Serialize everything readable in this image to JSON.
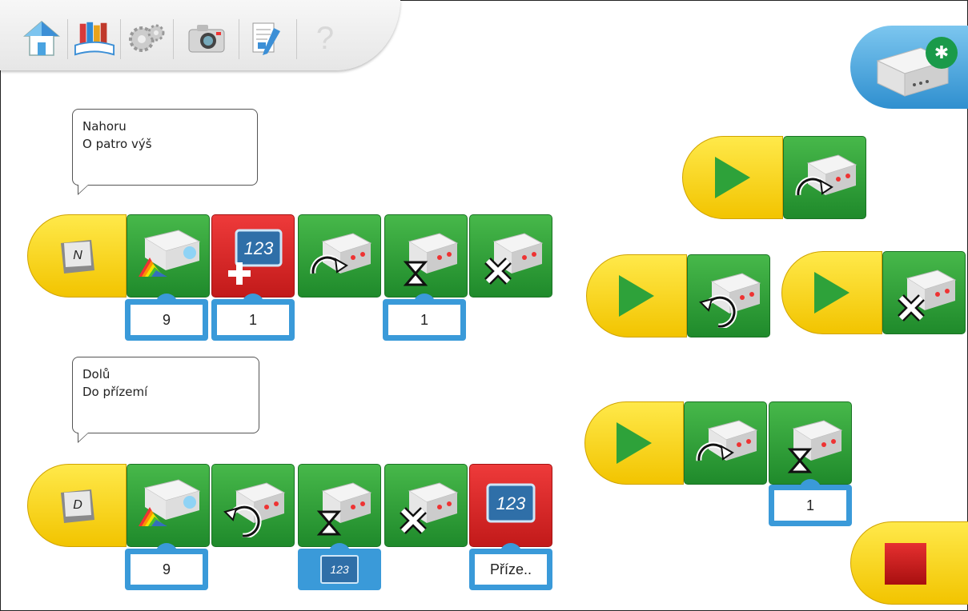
{
  "toolbar": {
    "icons": [
      "home-icon",
      "library-icon",
      "gears-icon",
      "camera-icon",
      "document-icon",
      "help-icon"
    ],
    "help_label": "?"
  },
  "comments": [
    {
      "line1": "Nahoru",
      "line2": "O patro výš"
    },
    {
      "line1": "Dolů",
      "line2": "Do přízemí"
    }
  ],
  "program_up": {
    "start_key": "N",
    "params": {
      "light": "9",
      "add": "1",
      "wait": "1"
    }
  },
  "program_down": {
    "start_key": "D",
    "params": {
      "light": "9",
      "display": "Příze.."
    }
  },
  "display_label": "123",
  "side_program": {
    "wait": "1"
  },
  "colors": {
    "green": "#2ea23a",
    "red": "#d42424",
    "yellow": "#f2c400",
    "blue": "#3a9ad9",
    "bluetooth": "#1a9a4a"
  }
}
